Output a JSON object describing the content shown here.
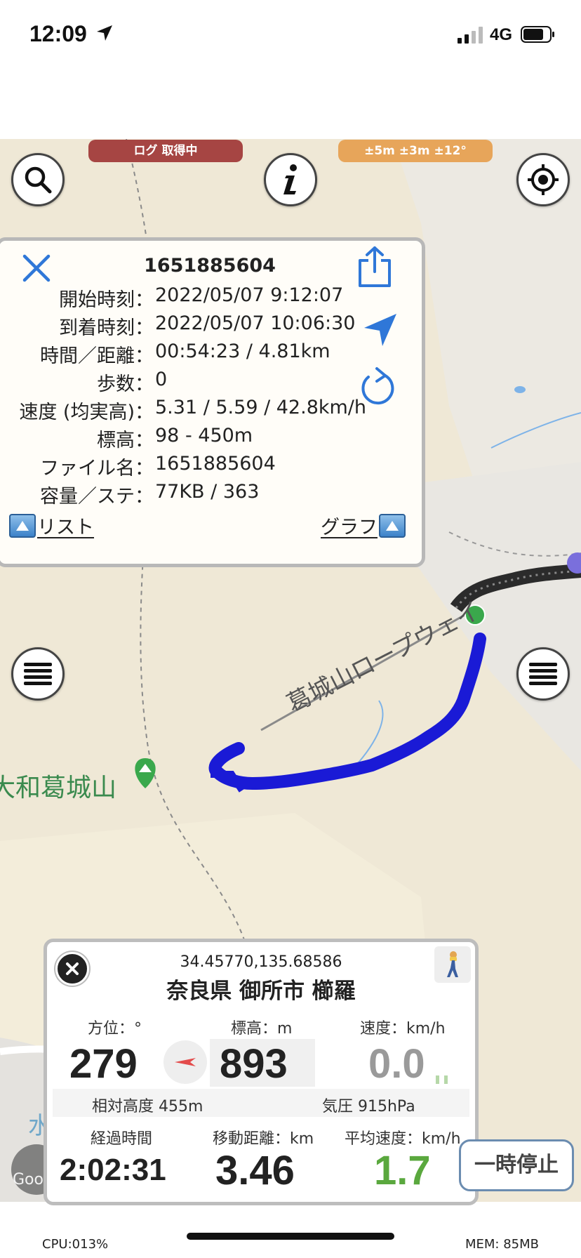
{
  "status_bar": {
    "time": "12:09",
    "network": "4G"
  },
  "badges": {
    "log_status": "ログ 取得中",
    "accuracy": "±5m ±3m ±12°"
  },
  "map": {
    "labels": {
      "mountain": "大和葛城山",
      "ropeway": "葛城山ロープウェイ",
      "bottom_left": "水越峠",
      "google": "Google"
    },
    "colors": {
      "track": "#1a1ad6",
      "track_dark": "#303030",
      "background": "#ece9e2",
      "green_area": "#f3edd8"
    }
  },
  "info_panel": {
    "title": "1651885604",
    "rows": [
      {
        "key": "開始時刻：",
        "value": "2022/05/07 9:12:07"
      },
      {
        "key": "到着時刻：",
        "value": "2022/05/07 10:06:30"
      },
      {
        "key": "時間／距離：",
        "value": "00:54:23 / 4.81km"
      },
      {
        "key": "歩数：",
        "value": "0"
      },
      {
        "key": "速度 (均実高)：",
        "value": "5.31 / 5.59 / 42.8km/h"
      },
      {
        "key": "標高：",
        "value": "98 - 450m"
      },
      {
        "key": "ファイル名：",
        "value": "1651885604"
      },
      {
        "key": "容量／ステ：",
        "value": "77KB / 363"
      }
    ],
    "list_label": "リスト",
    "graph_label": "グラフ"
  },
  "dashboard": {
    "coords": "34.45770,135.68586",
    "address": "奈良県 御所市 櫛羅",
    "bearing_label": "方位：°",
    "bearing_value": "279",
    "elevation_label": "標高：m",
    "elevation_value": "893",
    "speed_label": "速度：km/h",
    "speed_value": "0.0",
    "relative_altitude": "相対高度 455m",
    "pressure": "気圧 915hPa",
    "elapsed_label": "経過時間",
    "elapsed_value": "2:02:31",
    "distance_label": "移動距離：km",
    "distance_value": "3.46",
    "avg_speed_label": "平均速度：km/h",
    "avg_speed_value": "1.7"
  },
  "pause_button": "一時停止",
  "footer": {
    "cpu": "CPU:013%",
    "mem": "MEM: 85MB"
  }
}
